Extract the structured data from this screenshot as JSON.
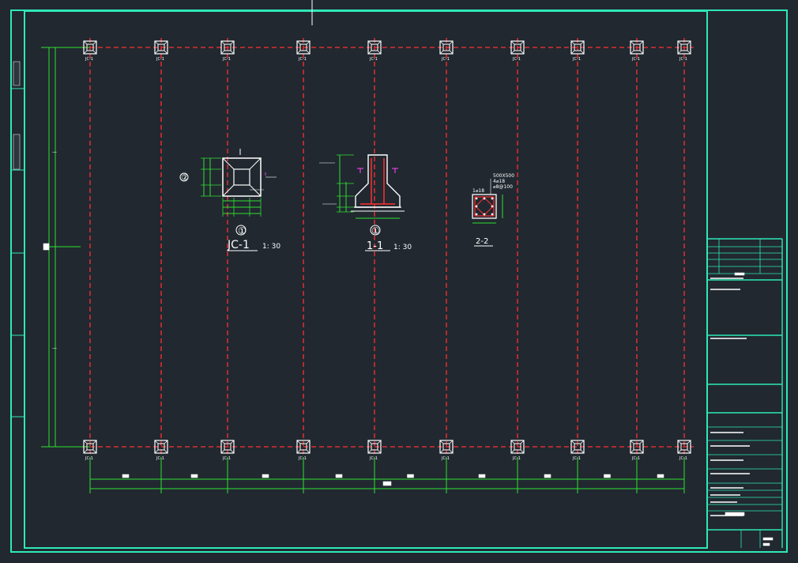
{
  "colors": {
    "background": "#212830",
    "frame": "#2ee8b8",
    "axis": "#ff3030",
    "dimension": "#30e030",
    "detail": "#ffffff",
    "accent": "#e040e0"
  },
  "plan": {
    "column_labels_top": [
      "JC-1",
      "JC-1",
      "JC-1",
      "JC-1",
      "JC-1",
      "JC-1",
      "JC-1",
      "JC-1",
      "JC-1",
      "JC-1"
    ],
    "column_labels_bottom": [
      "JC-1",
      "JC-1",
      "JC-1",
      "JC-1",
      "JC-1",
      "JC-1",
      "JC-1",
      "JC-1",
      "JC-1",
      "JC-1"
    ]
  },
  "details": {
    "plan_title": "JC-1",
    "plan_scale": "1: 30",
    "plan_marker": "①",
    "side_marker": "②",
    "section_title": "1-1",
    "section_scale": "1: 30",
    "section_marker": "①",
    "column_title": "2-2",
    "column_size": "500X500",
    "column_rebar_1": "4⌀18",
    "column_rebar_2": "⌀8@100",
    "column_rebar_3": "1⌀18"
  }
}
